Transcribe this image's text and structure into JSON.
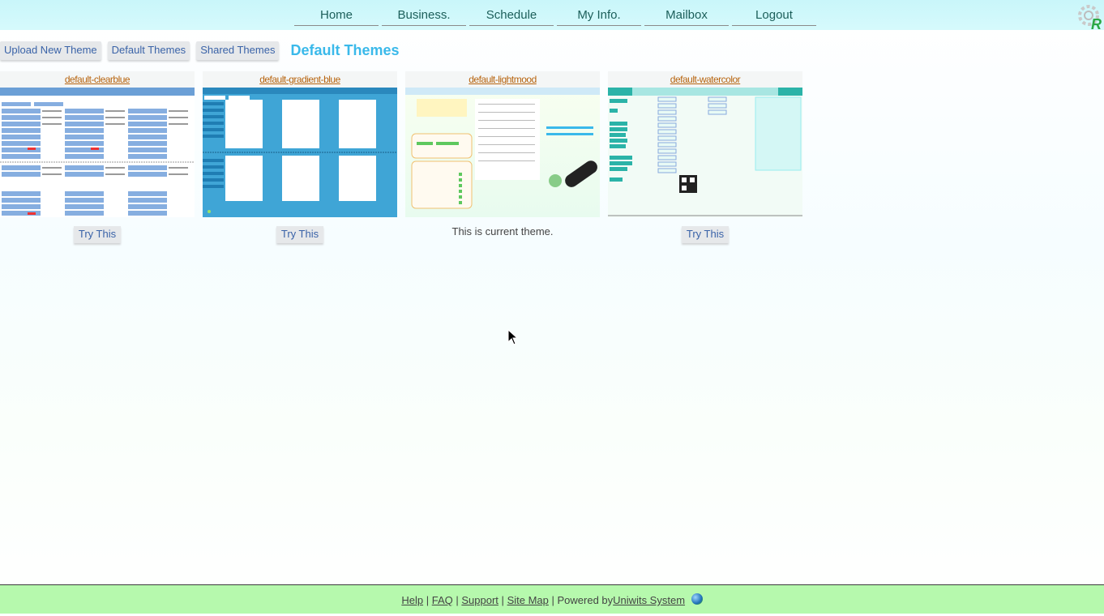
{
  "nav": {
    "items": [
      {
        "label": "Home"
      },
      {
        "label": "Business."
      },
      {
        "label": "Schedule"
      },
      {
        "label": "My Info."
      },
      {
        "label": "Mailbox"
      },
      {
        "label": "Logout"
      }
    ],
    "logo_icon": "gear-r-logo-icon"
  },
  "tabs": {
    "items": [
      {
        "label": "Upload New Theme"
      },
      {
        "label": "Default Themes"
      },
      {
        "label": "Shared Themes"
      }
    ],
    "page_title": "Default Themes"
  },
  "themes": [
    {
      "name": "default-clearblue",
      "action": "Try This",
      "current": false
    },
    {
      "name": "default-gradient-blue",
      "action": "Try This",
      "current": false
    },
    {
      "name": "default-lightmood",
      "status": "This is current theme.",
      "current": true
    },
    {
      "name": "default-watercolor",
      "action": "Try This",
      "current": false
    }
  ],
  "footer": {
    "links": [
      "Help",
      "FAQ",
      "Support",
      "Site Map"
    ],
    "separator": "|",
    "powered_by": "Powered by",
    "system_link": "Uniwits System",
    "globe_icon": "globe-icon"
  },
  "colors": {
    "header_bg": "#c9f6fa",
    "title_accent": "#3ab9ea",
    "theme_link": "#b7640f",
    "footer_bg": "#b6f9ad"
  }
}
